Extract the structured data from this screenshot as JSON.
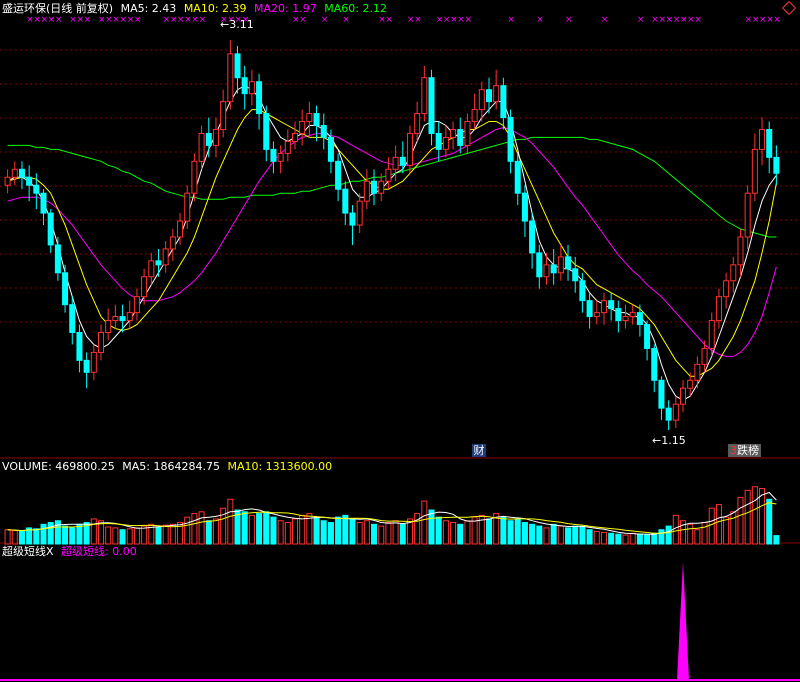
{
  "price_header": {
    "title": "盛运环保(日线 前复权)",
    "ma5": "MA5: 2.43",
    "ma10": "MA10: 2.39",
    "ma20": "MA20: 1.97",
    "ma60": "MA60: 2.12"
  },
  "volume_header": {
    "label": "VOLUME: 469800.25",
    "ma5": "MA5: 1864284.75",
    "ma10": "MA10: 1313600.00"
  },
  "indicator_header": {
    "name": "超级短线X",
    "value": "超级短线: 0.00"
  },
  "annotations": {
    "high": "3.11",
    "low": "1.15",
    "badge_finance": "财",
    "badge_rank_num": "3",
    "badge_rank_text": "跌榜"
  },
  "colors": {
    "up": "#ff3232",
    "down": "#00ffff",
    "ma5": "#ffffff",
    "ma10": "#ffff00",
    "ma20": "#ff00ff",
    "ma60": "#00ff00",
    "grid": "#8b0000",
    "indicator": "#ff00ff"
  },
  "chart_data": [
    {
      "type": "candlestick",
      "title": "盛运环保(日线 前复权)",
      "ylim": [
        1.1,
        3.2
      ],
      "series": [
        {
          "name": "MA5",
          "last": 2.43
        },
        {
          "name": "MA10",
          "last": 2.39
        },
        {
          "name": "MA20",
          "last": 1.97
        },
        {
          "name": "MA60",
          "last": 2.12
        }
      ],
      "points": [
        [
          2.38,
          2.42,
          2.46,
          2.34
        ],
        [
          2.42,
          2.46,
          2.5,
          2.38
        ],
        [
          2.46,
          2.42,
          2.5,
          2.36
        ],
        [
          2.42,
          2.38,
          2.48,
          2.3
        ],
        [
          2.38,
          2.34,
          2.44,
          2.26
        ],
        [
          2.34,
          2.24,
          2.36,
          2.18
        ],
        [
          2.24,
          2.08,
          2.26,
          2.04
        ],
        [
          2.08,
          1.94,
          2.12,
          1.9
        ],
        [
          1.94,
          1.78,
          1.98,
          1.74
        ],
        [
          1.78,
          1.64,
          1.82,
          1.58
        ],
        [
          1.64,
          1.5,
          1.68,
          1.44
        ],
        [
          1.5,
          1.44,
          1.54,
          1.36
        ],
        [
          1.44,
          1.54,
          1.58,
          1.4
        ],
        [
          1.54,
          1.64,
          1.68,
          1.5
        ],
        [
          1.64,
          1.7,
          1.76,
          1.6
        ],
        [
          1.7,
          1.72,
          1.78,
          1.66
        ],
        [
          1.72,
          1.7,
          1.78,
          1.64
        ],
        [
          1.7,
          1.74,
          1.8,
          1.66
        ],
        [
          1.74,
          1.82,
          1.86,
          1.7
        ],
        [
          1.82,
          1.92,
          1.96,
          1.78
        ],
        [
          1.92,
          2.0,
          2.04,
          1.88
        ],
        [
          2.0,
          1.98,
          2.06,
          1.92
        ],
        [
          1.98,
          2.06,
          2.1,
          1.94
        ],
        [
          2.06,
          2.12,
          2.16,
          2.0
        ],
        [
          2.12,
          2.2,
          2.24,
          2.08
        ],
        [
          2.2,
          2.34,
          2.38,
          2.16
        ],
        [
          2.34,
          2.5,
          2.54,
          2.3
        ],
        [
          2.5,
          2.64,
          2.68,
          2.46
        ],
        [
          2.64,
          2.58,
          2.72,
          2.52
        ],
        [
          2.58,
          2.66,
          2.72,
          2.52
        ],
        [
          2.66,
          2.8,
          2.86,
          2.62
        ],
        [
          2.8,
          3.04,
          3.11,
          2.76
        ],
        [
          3.04,
          2.92,
          3.08,
          2.84
        ],
        [
          2.92,
          2.84,
          2.98,
          2.76
        ],
        [
          2.84,
          2.9,
          2.96,
          2.78
        ],
        [
          2.9,
          2.74,
          2.94,
          2.66
        ],
        [
          2.74,
          2.56,
          2.78,
          2.5
        ],
        [
          2.56,
          2.5,
          2.6,
          2.44
        ],
        [
          2.5,
          2.54,
          2.58,
          2.44
        ],
        [
          2.54,
          2.6,
          2.66,
          2.5
        ],
        [
          2.6,
          2.64,
          2.7,
          2.56
        ],
        [
          2.64,
          2.7,
          2.76,
          2.58
        ],
        [
          2.7,
          2.74,
          2.8,
          2.62
        ],
        [
          2.74,
          2.68,
          2.78,
          2.6
        ],
        [
          2.68,
          2.62,
          2.74,
          2.56
        ],
        [
          2.62,
          2.5,
          2.66,
          2.44
        ],
        [
          2.5,
          2.36,
          2.54,
          2.3
        ],
        [
          2.36,
          2.24,
          2.4,
          2.18
        ],
        [
          2.24,
          2.18,
          2.28,
          2.08
        ],
        [
          2.18,
          2.3,
          2.34,
          2.14
        ],
        [
          2.3,
          2.4,
          2.46,
          2.26
        ],
        [
          2.4,
          2.34,
          2.46,
          2.28
        ],
        [
          2.34,
          2.4,
          2.44,
          2.3
        ],
        [
          2.4,
          2.46,
          2.52,
          2.36
        ],
        [
          2.46,
          2.52,
          2.58,
          2.4
        ],
        [
          2.52,
          2.48,
          2.6,
          2.44
        ],
        [
          2.48,
          2.64,
          2.68,
          2.44
        ],
        [
          2.64,
          2.74,
          2.8,
          2.6
        ],
        [
          2.74,
          2.92,
          2.98,
          2.7
        ],
        [
          2.92,
          2.64,
          2.96,
          2.58
        ],
        [
          2.64,
          2.56,
          2.7,
          2.5
        ],
        [
          2.56,
          2.62,
          2.68,
          2.52
        ],
        [
          2.62,
          2.66,
          2.7,
          2.56
        ],
        [
          2.66,
          2.58,
          2.72,
          2.54
        ],
        [
          2.58,
          2.7,
          2.74,
          2.54
        ],
        [
          2.7,
          2.76,
          2.84,
          2.66
        ],
        [
          2.76,
          2.86,
          2.9,
          2.7
        ],
        [
          2.86,
          2.8,
          2.92,
          2.74
        ],
        [
          2.8,
          2.88,
          2.96,
          2.76
        ],
        [
          2.88,
          2.72,
          2.92,
          2.66
        ],
        [
          2.72,
          2.5,
          2.76,
          2.44
        ],
        [
          2.5,
          2.34,
          2.54,
          2.28
        ],
        [
          2.34,
          2.2,
          2.38,
          2.12
        ],
        [
          2.2,
          2.04,
          2.24,
          1.96
        ],
        [
          2.04,
          1.92,
          2.08,
          1.86
        ],
        [
          1.92,
          1.98,
          2.04,
          1.88
        ],
        [
          1.98,
          1.94,
          2.06,
          1.88
        ],
        [
          1.94,
          2.02,
          2.08,
          1.9
        ],
        [
          2.02,
          1.96,
          2.08,
          1.9
        ],
        [
          1.96,
          1.9,
          2.02,
          1.84
        ],
        [
          1.9,
          1.8,
          1.94,
          1.74
        ],
        [
          1.8,
          1.72,
          1.84,
          1.66
        ],
        [
          1.72,
          1.74,
          1.8,
          1.68
        ],
        [
          1.74,
          1.8,
          1.84,
          1.68
        ],
        [
          1.8,
          1.76,
          1.84,
          1.7
        ],
        [
          1.76,
          1.7,
          1.8,
          1.64
        ],
        [
          1.7,
          1.72,
          1.78,
          1.66
        ],
        [
          1.72,
          1.74,
          1.78,
          1.68
        ],
        [
          1.74,
          1.68,
          1.78,
          1.62
        ],
        [
          1.68,
          1.56,
          1.7,
          1.5
        ],
        [
          1.56,
          1.4,
          1.58,
          1.34
        ],
        [
          1.4,
          1.26,
          1.42,
          1.2
        ],
        [
          1.26,
          1.2,
          1.3,
          1.15
        ],
        [
          1.2,
          1.28,
          1.32,
          1.16
        ],
        [
          1.28,
          1.36,
          1.4,
          1.24
        ],
        [
          1.36,
          1.4,
          1.44,
          1.32
        ],
        [
          1.4,
          1.48,
          1.52,
          1.36
        ],
        [
          1.48,
          1.56,
          1.6,
          1.44
        ],
        [
          1.56,
          1.7,
          1.74,
          1.52
        ],
        [
          1.7,
          1.82,
          1.86,
          1.66
        ],
        [
          1.82,
          1.9,
          1.94,
          1.76
        ],
        [
          1.9,
          1.98,
          2.02,
          1.84
        ],
        [
          1.98,
          2.12,
          2.16,
          1.92
        ],
        [
          2.12,
          2.34,
          2.38,
          2.06
        ],
        [
          2.34,
          2.56,
          2.64,
          2.3
        ],
        [
          2.56,
          2.66,
          2.72,
          2.48
        ],
        [
          2.66,
          2.52,
          2.7,
          2.44
        ],
        [
          2.52,
          2.44,
          2.58,
          2.38
        ]
      ],
      "ma5": [
        2.4,
        2.42,
        2.42,
        2.4,
        2.36,
        2.3,
        2.2,
        2.08,
        1.94,
        1.82,
        1.7,
        1.62,
        1.58,
        1.56,
        1.58,
        1.62,
        1.66,
        1.7,
        1.76,
        1.82,
        1.88,
        1.94,
        2.0,
        2.06,
        2.12,
        2.22,
        2.34,
        2.46,
        2.56,
        2.64,
        2.72,
        2.8,
        2.86,
        2.88,
        2.86,
        2.82,
        2.74,
        2.68,
        2.62,
        2.6,
        2.62,
        2.64,
        2.68,
        2.68,
        2.66,
        2.62,
        2.56,
        2.46,
        2.36,
        2.32,
        2.32,
        2.34,
        2.36,
        2.4,
        2.44,
        2.46,
        2.52,
        2.6,
        2.68,
        2.7,
        2.7,
        2.68,
        2.64,
        2.62,
        2.62,
        2.66,
        2.72,
        2.76,
        2.8,
        2.8,
        2.7,
        2.56,
        2.4,
        2.24,
        2.1,
        2.02,
        1.98,
        1.96,
        1.96,
        1.94,
        1.9,
        1.84,
        1.8,
        1.78,
        1.76,
        1.74,
        1.74,
        1.72,
        1.72,
        1.68,
        1.6,
        1.48,
        1.38,
        1.32,
        1.3,
        1.32,
        1.38,
        1.44,
        1.52,
        1.62,
        1.72,
        1.82,
        1.92,
        2.04,
        2.18,
        2.3,
        2.38,
        2.43
      ],
      "ma10": [
        2.4,
        2.41,
        2.42,
        2.42,
        2.41,
        2.38,
        2.34,
        2.26,
        2.18,
        2.08,
        1.98,
        1.88,
        1.8,
        1.72,
        1.68,
        1.66,
        1.65,
        1.66,
        1.68,
        1.72,
        1.76,
        1.8,
        1.86,
        1.92,
        1.98,
        2.04,
        2.12,
        2.22,
        2.32,
        2.42,
        2.5,
        2.58,
        2.66,
        2.72,
        2.76,
        2.76,
        2.74,
        2.72,
        2.7,
        2.68,
        2.66,
        2.64,
        2.62,
        2.62,
        2.62,
        2.6,
        2.56,
        2.52,
        2.48,
        2.44,
        2.4,
        2.38,
        2.36,
        2.36,
        2.38,
        2.4,
        2.44,
        2.48,
        2.52,
        2.56,
        2.58,
        2.6,
        2.62,
        2.64,
        2.66,
        2.66,
        2.68,
        2.7,
        2.7,
        2.68,
        2.62,
        2.54,
        2.46,
        2.38,
        2.3,
        2.22,
        2.14,
        2.08,
        2.02,
        1.98,
        1.96,
        1.92,
        1.88,
        1.86,
        1.84,
        1.82,
        1.8,
        1.78,
        1.76,
        1.72,
        1.68,
        1.62,
        1.56,
        1.5,
        1.46,
        1.42,
        1.42,
        1.44,
        1.46,
        1.5,
        1.56,
        1.62,
        1.7,
        1.8,
        1.9,
        2.04,
        2.2,
        2.39
      ],
      "ma20": [
        2.3,
        2.31,
        2.32,
        2.32,
        2.32,
        2.31,
        2.29,
        2.26,
        2.22,
        2.18,
        2.13,
        2.08,
        2.03,
        1.98,
        1.94,
        1.9,
        1.86,
        1.83,
        1.81,
        1.8,
        1.8,
        1.8,
        1.81,
        1.82,
        1.84,
        1.87,
        1.9,
        1.94,
        1.99,
        2.04,
        2.1,
        2.16,
        2.22,
        2.28,
        2.34,
        2.4,
        2.45,
        2.5,
        2.54,
        2.57,
        2.6,
        2.62,
        2.63,
        2.64,
        2.64,
        2.63,
        2.62,
        2.6,
        2.58,
        2.56,
        2.54,
        2.52,
        2.5,
        2.49,
        2.48,
        2.48,
        2.48,
        2.49,
        2.5,
        2.51,
        2.52,
        2.53,
        2.54,
        2.56,
        2.58,
        2.6,
        2.62,
        2.64,
        2.66,
        2.67,
        2.66,
        2.64,
        2.62,
        2.59,
        2.55,
        2.51,
        2.47,
        2.42,
        2.37,
        2.32,
        2.28,
        2.23,
        2.18,
        2.13,
        2.08,
        2.03,
        1.99,
        1.95,
        1.92,
        1.88,
        1.85,
        1.82,
        1.78,
        1.74,
        1.7,
        1.66,
        1.62,
        1.58,
        1.55,
        1.53,
        1.52,
        1.52,
        1.54,
        1.58,
        1.64,
        1.72,
        1.84,
        1.97
      ],
      "ma60": [
        2.58,
        2.58,
        2.58,
        2.58,
        2.57,
        2.57,
        2.56,
        2.56,
        2.55,
        2.54,
        2.53,
        2.52,
        2.51,
        2.5,
        2.48,
        2.47,
        2.45,
        2.44,
        2.42,
        2.4,
        2.39,
        2.37,
        2.35,
        2.34,
        2.33,
        2.32,
        2.32,
        2.31,
        2.31,
        2.31,
        2.31,
        2.32,
        2.32,
        2.32,
        2.33,
        2.33,
        2.33,
        2.33,
        2.34,
        2.34,
        2.34,
        2.35,
        2.35,
        2.36,
        2.37,
        2.38,
        2.38,
        2.39,
        2.4,
        2.4,
        2.41,
        2.42,
        2.42,
        2.43,
        2.44,
        2.45,
        2.46,
        2.47,
        2.48,
        2.49,
        2.5,
        2.51,
        2.52,
        2.53,
        2.54,
        2.55,
        2.56,
        2.57,
        2.58,
        2.59,
        2.6,
        2.61,
        2.61,
        2.62,
        2.62,
        2.62,
        2.62,
        2.62,
        2.62,
        2.62,
        2.62,
        2.61,
        2.61,
        2.6,
        2.59,
        2.58,
        2.57,
        2.56,
        2.54,
        2.52,
        2.5,
        2.47,
        2.44,
        2.41,
        2.38,
        2.35,
        2.32,
        2.29,
        2.26,
        2.23,
        2.2,
        2.18,
        2.16,
        2.15,
        2.14,
        2.13,
        2.12,
        2.12
      ]
    },
    {
      "type": "bar",
      "title": "VOLUME",
      "series": [
        {
          "name": "VOLUME",
          "last": 469800.25
        },
        {
          "name": "MA5",
          "last": 1864284.75
        },
        {
          "name": "MA10",
          "last": 1313600.0
        }
      ],
      "ylim": [
        0,
        3800000
      ],
      "values": [
        800000,
        750000,
        700000,
        900000,
        850000,
        1100000,
        1200000,
        1300000,
        1000000,
        900000,
        1100000,
        1200000,
        1400000,
        1300000,
        950000,
        900000,
        800000,
        850000,
        900000,
        1000000,
        1100000,
        950000,
        1050000,
        1100000,
        1200000,
        1500000,
        1700000,
        1800000,
        1300000,
        1400000,
        2000000,
        2500000,
        1900000,
        1800000,
        1600000,
        1700000,
        1800000,
        1500000,
        1300000,
        1200000,
        1400000,
        1600000,
        1700000,
        1500000,
        1300000,
        1200000,
        1500000,
        1600000,
        1400000,
        1200000,
        1300000,
        1100000,
        1000000,
        1200000,
        1300000,
        1100000,
        1400000,
        1700000,
        2400000,
        1900000,
        1500000,
        1300000,
        1200000,
        1100000,
        1300000,
        1500000,
        1600000,
        1400000,
        1700000,
        1500000,
        1300000,
        1400000,
        1200000,
        1100000,
        1000000,
        900000,
        1100000,
        1000000,
        900000,
        1000000,
        950000,
        800000,
        700000,
        650000,
        600000,
        550000,
        500000,
        600000,
        550000,
        500000,
        600000,
        800000,
        1000000,
        1600000,
        1300000,
        1100000,
        800000,
        1200000,
        2000000,
        2200000,
        1500000,
        1800000,
        2600000,
        3000000,
        3200000,
        3100000,
        2500000,
        469800
      ]
    },
    {
      "type": "area",
      "title": "超级短线X",
      "series": [
        {
          "name": "超级短线",
          "last": 0.0
        }
      ],
      "ylim": [
        0,
        1
      ],
      "peak_index": 94,
      "peak_value": 1
    }
  ]
}
